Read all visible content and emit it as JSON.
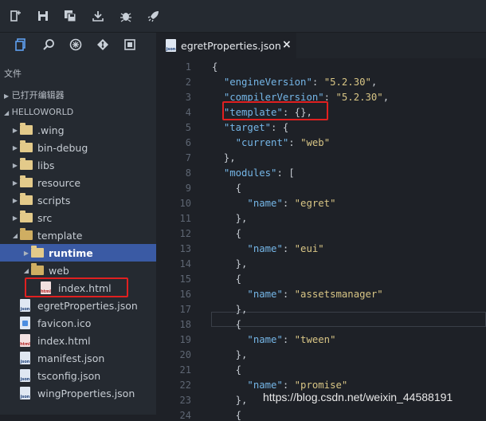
{
  "toolbar": {
    "buttons": [
      "new-file-icon",
      "save-icon",
      "save-all-icon",
      "publish-icon",
      "debug-icon",
      "run-icon"
    ]
  },
  "sidebar": {
    "activity_icons": [
      "explorer-icon",
      "search-icon",
      "extensions-icon",
      "git-icon",
      "debug-panel-icon"
    ],
    "section_title": "文件",
    "open_editors": "已打开编辑器",
    "project_title": "HELLOWORLD",
    "tree": [
      {
        "label": ".wing",
        "type": "folder",
        "depth": 1,
        "expanded": false
      },
      {
        "label": "bin-debug",
        "type": "folder",
        "depth": 1,
        "expanded": false
      },
      {
        "label": "libs",
        "type": "folder",
        "depth": 1,
        "expanded": false
      },
      {
        "label": "resource",
        "type": "folder",
        "depth": 1,
        "expanded": false
      },
      {
        "label": "scripts",
        "type": "folder",
        "depth": 1,
        "expanded": false
      },
      {
        "label": "src",
        "type": "folder",
        "depth": 1,
        "expanded": false
      },
      {
        "label": "template",
        "type": "folder",
        "depth": 1,
        "expanded": true
      },
      {
        "label": "runtime",
        "type": "folder",
        "depth": 2,
        "expanded": false,
        "selected": true
      },
      {
        "label": "web",
        "type": "folder",
        "depth": 2,
        "expanded": true
      },
      {
        "label": "index.html",
        "type": "html",
        "depth": 3,
        "highlighted": true
      },
      {
        "label": "egretProperties.json",
        "type": "json",
        "depth": 1
      },
      {
        "label": "favicon.ico",
        "type": "ico",
        "depth": 1
      },
      {
        "label": "index.html",
        "type": "html",
        "depth": 1
      },
      {
        "label": "manifest.json",
        "type": "json",
        "depth": 1
      },
      {
        "label": "tsconfig.json",
        "type": "json",
        "depth": 1
      },
      {
        "label": "wingProperties.json",
        "type": "json",
        "depth": 1
      }
    ]
  },
  "editor": {
    "tab_label": "egretProperties.json",
    "tab_close": "×",
    "json_badge": "json",
    "html_badge": "html",
    "lines": [
      {
        "n": "1",
        "tokens": [
          [
            "p",
            "{"
          ]
        ]
      },
      {
        "n": "2",
        "tokens": [
          [
            "p",
            "  "
          ],
          [
            "k",
            "\"engineVersion\""
          ],
          [
            "p",
            ": "
          ],
          [
            "s",
            "\"5.2.30\""
          ],
          [
            "p",
            ","
          ]
        ]
      },
      {
        "n": "3",
        "tokens": [
          [
            "p",
            "  "
          ],
          [
            "k",
            "\"compilerVersion\""
          ],
          [
            "p",
            ": "
          ],
          [
            "s",
            "\"5.2.30\""
          ],
          [
            "p",
            ","
          ]
        ]
      },
      {
        "n": "4",
        "tokens": [
          [
            "p",
            "  "
          ],
          [
            "k",
            "\"template\""
          ],
          [
            "p",
            ": {},"
          ]
        ]
      },
      {
        "n": "5",
        "tokens": [
          [
            "p",
            "  "
          ],
          [
            "k",
            "\"target\""
          ],
          [
            "p",
            ": {"
          ]
        ]
      },
      {
        "n": "6",
        "tokens": [
          [
            "p",
            "    "
          ],
          [
            "k",
            "\"current\""
          ],
          [
            "p",
            ": "
          ],
          [
            "s",
            "\"web\""
          ]
        ]
      },
      {
        "n": "7",
        "tokens": [
          [
            "p",
            "  },"
          ]
        ]
      },
      {
        "n": "8",
        "tokens": [
          [
            "p",
            "  "
          ],
          [
            "k",
            "\"modules\""
          ],
          [
            "p",
            ": ["
          ]
        ]
      },
      {
        "n": "9",
        "tokens": [
          [
            "p",
            "    {"
          ]
        ]
      },
      {
        "n": "10",
        "tokens": [
          [
            "p",
            "      "
          ],
          [
            "k",
            "\"name\""
          ],
          [
            "p",
            ": "
          ],
          [
            "s",
            "\"egret\""
          ]
        ]
      },
      {
        "n": "11",
        "tokens": [
          [
            "p",
            "    },"
          ]
        ]
      },
      {
        "n": "12",
        "tokens": [
          [
            "p",
            "    {"
          ]
        ]
      },
      {
        "n": "13",
        "tokens": [
          [
            "p",
            "      "
          ],
          [
            "k",
            "\"name\""
          ],
          [
            "p",
            ": "
          ],
          [
            "s",
            "\"eui\""
          ]
        ]
      },
      {
        "n": "14",
        "tokens": [
          [
            "p",
            "    },"
          ]
        ]
      },
      {
        "n": "15",
        "tokens": [
          [
            "p",
            "    {"
          ]
        ]
      },
      {
        "n": "16",
        "tokens": [
          [
            "p",
            "      "
          ],
          [
            "k",
            "\"name\""
          ],
          [
            "p",
            ": "
          ],
          [
            "s",
            "\"assetsmanager\""
          ]
        ]
      },
      {
        "n": "17",
        "tokens": [
          [
            "p",
            "    },"
          ]
        ]
      },
      {
        "n": "18",
        "tokens": [
          [
            "p",
            "    {"
          ]
        ]
      },
      {
        "n": "19",
        "tokens": [
          [
            "p",
            "      "
          ],
          [
            "k",
            "\"name\""
          ],
          [
            "p",
            ": "
          ],
          [
            "s",
            "\"tween\""
          ]
        ]
      },
      {
        "n": "20",
        "tokens": [
          [
            "p",
            "    },"
          ]
        ]
      },
      {
        "n": "21",
        "tokens": [
          [
            "p",
            "    {"
          ]
        ]
      },
      {
        "n": "22",
        "tokens": [
          [
            "p",
            "      "
          ],
          [
            "k",
            "\"name\""
          ],
          [
            "p",
            ": "
          ],
          [
            "s",
            "\"promise\""
          ]
        ]
      },
      {
        "n": "23",
        "tokens": [
          [
            "p",
            "    },"
          ]
        ]
      },
      {
        "n": "24",
        "tokens": [
          [
            "p",
            "    {"
          ]
        ]
      }
    ]
  },
  "watermark": "https://blog.csdn.net/weixin_44588191",
  "colors": {
    "accent": "#3a5aa4",
    "annotation": "#e02020"
  }
}
